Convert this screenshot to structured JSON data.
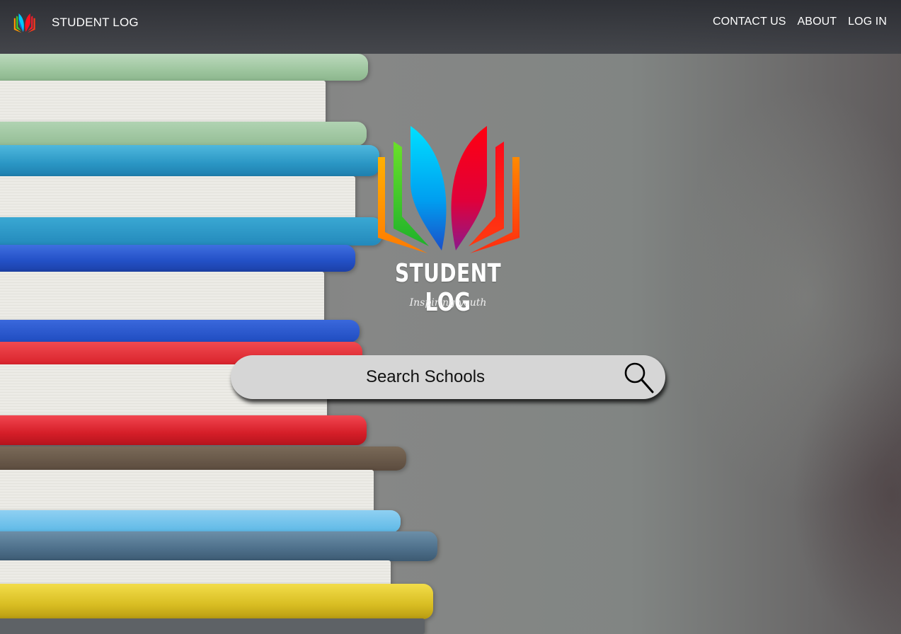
{
  "navbar": {
    "brand": "STUDENT LOG",
    "links": [
      "CONTACT US",
      "ABOUT",
      "LOG IN"
    ]
  },
  "hero": {
    "title": "STUDENT LOG",
    "tagline": "Inspiring youth"
  },
  "search": {
    "placeholder": "Search Schools"
  },
  "icons": {
    "logo": "open-book-logo-icon",
    "search": "magnifier-icon"
  },
  "colors": {
    "logo_orange": "#ff9a00",
    "logo_green": "#3ed12c",
    "logo_cyan": "#00c8ff",
    "logo_blue": "#1a5fd6",
    "logo_red": "#ff1020",
    "logo_magenta": "#c8007a",
    "search_bg": "#d6d6d6"
  }
}
